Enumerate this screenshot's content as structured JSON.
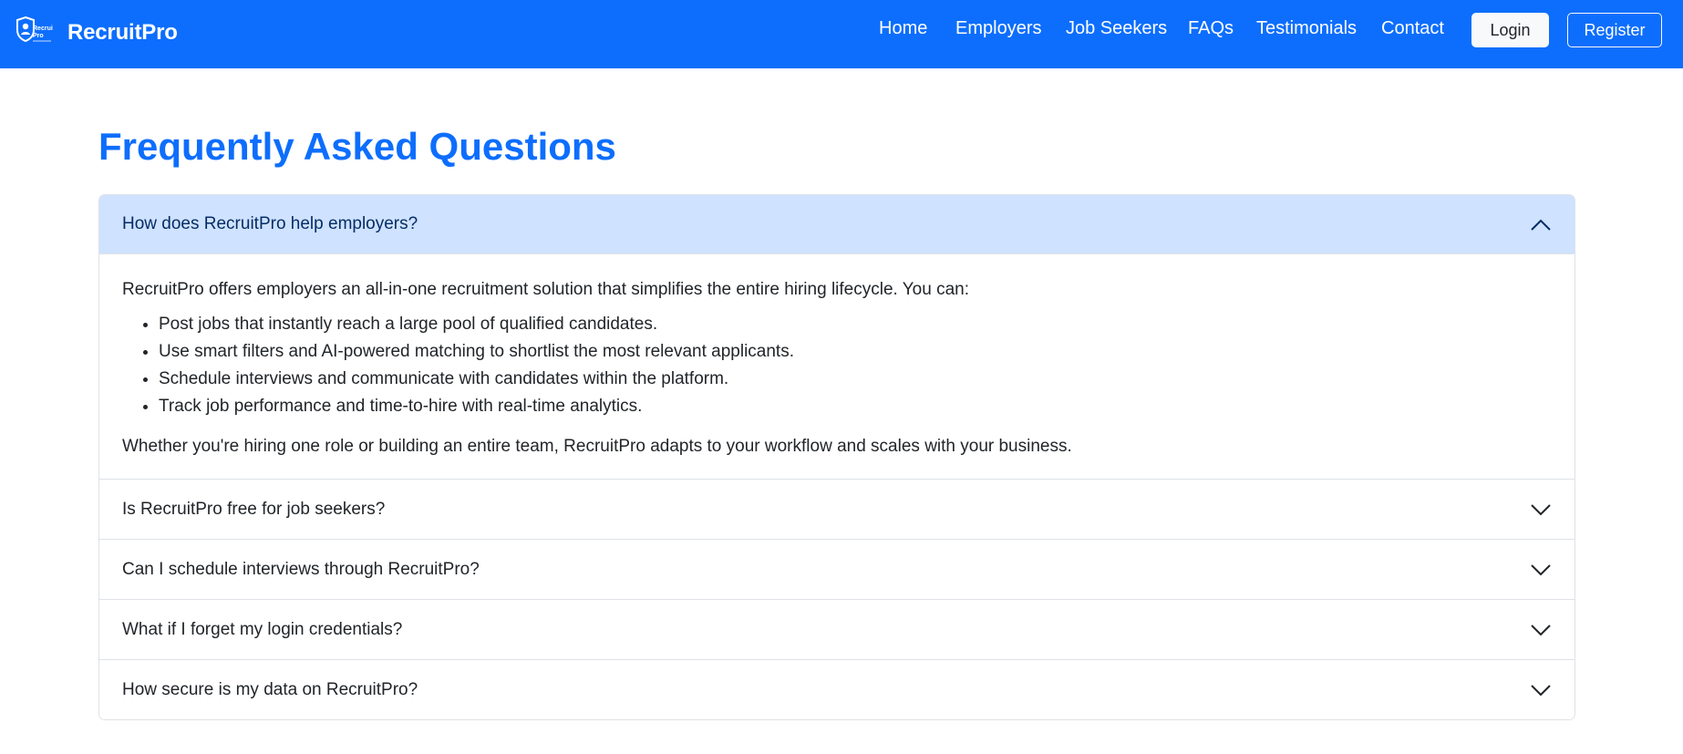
{
  "brand": {
    "name": "RecruitPro",
    "logo_text": "Recruit Pro"
  },
  "nav": {
    "links": [
      "Home",
      "Employers",
      "Job Seekers",
      "FAQs",
      "Testimonials",
      "Contact"
    ],
    "login_label": "Login",
    "register_label": "Register"
  },
  "faq": {
    "title": "Frequently Asked Questions",
    "items": [
      {
        "question": "How does RecruitPro help employers?",
        "expanded": true,
        "answer_intro": "RecruitPro offers employers an all-in-one recruitment solution that simplifies the entire hiring lifecycle. You can:",
        "answer_points": [
          "Post jobs that instantly reach a large pool of qualified candidates.",
          "Use smart filters and AI-powered matching to shortlist the most relevant applicants.",
          "Schedule interviews and communicate with candidates within the platform.",
          "Track job performance and time-to-hire with real-time analytics."
        ],
        "answer_outro": "Whether you're hiring one role or building an entire team, RecruitPro adapts to your workflow and scales with your business."
      },
      {
        "question": "Is RecruitPro free for job seekers?",
        "expanded": false
      },
      {
        "question": "Can I schedule interviews through RecruitPro?",
        "expanded": false
      },
      {
        "question": "What if I forget my login credentials?",
        "expanded": false
      },
      {
        "question": "How secure is my data on RecruitPro?",
        "expanded": false
      }
    ]
  },
  "colors": {
    "primary": "#0d6efd",
    "accordion_open_bg": "#cfe2ff",
    "border": "#dee2e6"
  },
  "icons": {
    "expanded": "chevron-up-icon",
    "collapsed": "chevron-down-icon"
  }
}
